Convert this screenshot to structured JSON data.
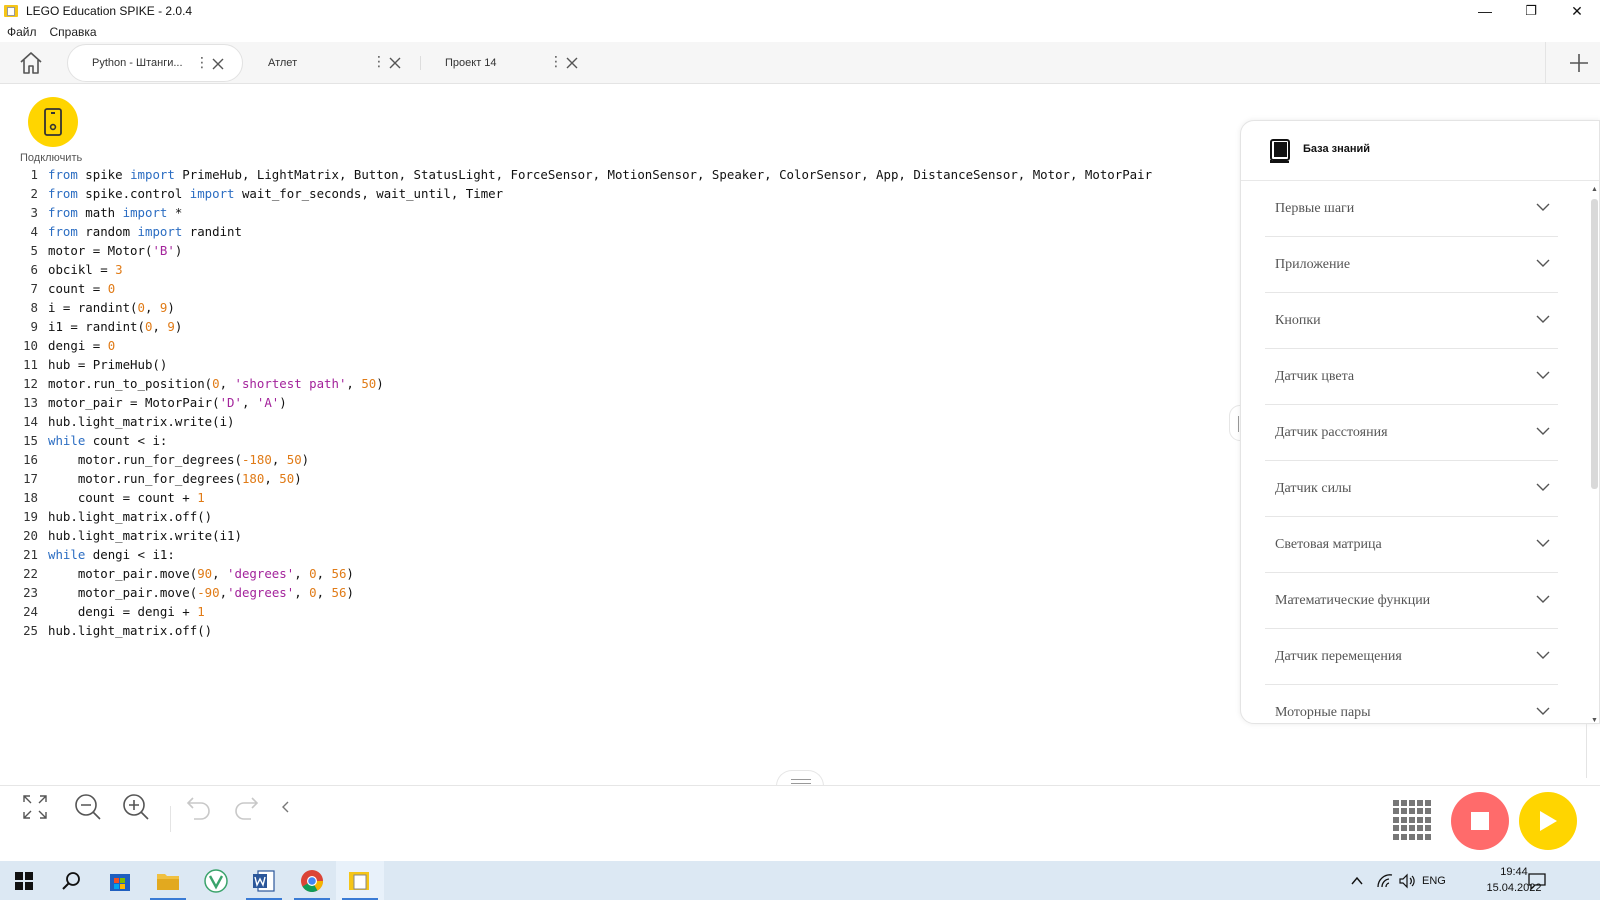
{
  "window": {
    "title": "LEGO Education SPIKE - 2.0.4",
    "controls": {
      "minimize": "—",
      "maximize": "❐",
      "close": "✕"
    }
  },
  "menu": {
    "items": [
      "Файл",
      "Справка"
    ]
  },
  "tabs": [
    {
      "label": "Python - Штанги...",
      "active": true
    },
    {
      "label": "Атлет",
      "active": false
    },
    {
      "label": "Проект 14",
      "active": false
    }
  ],
  "connect": {
    "label": "Подключить"
  },
  "code": {
    "lines": [
      [
        [
          "kw",
          "from"
        ],
        [
          "txt",
          " spike "
        ],
        [
          "kw",
          "import"
        ],
        [
          "txt",
          " PrimeHub, LightMatrix, Button, StatusLight, ForceSensor, MotionSensor, Speaker, ColorSensor, App, DistanceSensor, Motor, MotorPair"
        ]
      ],
      [
        [
          "kw",
          "from"
        ],
        [
          "txt",
          " spike.control "
        ],
        [
          "kw",
          "import"
        ],
        [
          "txt",
          " wait_for_seconds, wait_until, Timer"
        ]
      ],
      [
        [
          "kw",
          "from"
        ],
        [
          "txt",
          " math "
        ],
        [
          "kw",
          "import"
        ],
        [
          "txt",
          " *"
        ]
      ],
      [
        [
          "kw",
          "from"
        ],
        [
          "txt",
          " random "
        ],
        [
          "kw",
          "import"
        ],
        [
          "txt",
          " randint"
        ]
      ],
      [
        [
          "txt",
          "motor = Motor("
        ],
        [
          "str",
          "'B'"
        ],
        [
          "txt",
          ")"
        ]
      ],
      [
        [
          "txt",
          "obcikl = "
        ],
        [
          "num",
          "3"
        ]
      ],
      [
        [
          "txt",
          "count = "
        ],
        [
          "num",
          "0"
        ]
      ],
      [
        [
          "txt",
          "i = randint("
        ],
        [
          "num",
          "0"
        ],
        [
          "txt",
          ", "
        ],
        [
          "num",
          "9"
        ],
        [
          "txt",
          ")"
        ]
      ],
      [
        [
          "txt",
          "i1 = randint("
        ],
        [
          "num",
          "0"
        ],
        [
          "txt",
          ", "
        ],
        [
          "num",
          "9"
        ],
        [
          "txt",
          ")"
        ]
      ],
      [
        [
          "txt",
          "dengi = "
        ],
        [
          "num",
          "0"
        ]
      ],
      [
        [
          "txt",
          "hub = PrimeHub()"
        ]
      ],
      [
        [
          "txt",
          "motor.run_to_position("
        ],
        [
          "num",
          "0"
        ],
        [
          "txt",
          ", "
        ],
        [
          "str",
          "'shortest path'"
        ],
        [
          "txt",
          ", "
        ],
        [
          "num",
          "50"
        ],
        [
          "txt",
          ")"
        ]
      ],
      [
        [
          "txt",
          "motor_pair = MotorPair("
        ],
        [
          "str",
          "'D'"
        ],
        [
          "txt",
          ", "
        ],
        [
          "str",
          "'A'"
        ],
        [
          "txt",
          ")"
        ]
      ],
      [
        [
          "txt",
          "hub.light_matrix.write(i)"
        ]
      ],
      [
        [
          "kw",
          "while"
        ],
        [
          "txt",
          " count < i:"
        ]
      ],
      [
        [
          "txt",
          "    motor.run_for_degrees("
        ],
        [
          "num",
          "-180"
        ],
        [
          "txt",
          ", "
        ],
        [
          "num",
          "50"
        ],
        [
          "txt",
          ")"
        ]
      ],
      [
        [
          "txt",
          "    motor.run_for_degrees("
        ],
        [
          "num",
          "180"
        ],
        [
          "txt",
          ", "
        ],
        [
          "num",
          "50"
        ],
        [
          "txt",
          ")"
        ]
      ],
      [
        [
          "txt",
          "    count = count + "
        ],
        [
          "num",
          "1"
        ]
      ],
      [
        [
          "txt",
          "hub.light_matrix.off()"
        ]
      ],
      [
        [
          "txt",
          "hub.light_matrix.write(i1)"
        ]
      ],
      [
        [
          "kw",
          "while"
        ],
        [
          "txt",
          " dengi < i1:"
        ]
      ],
      [
        [
          "txt",
          "    motor_pair.move("
        ],
        [
          "num",
          "90"
        ],
        [
          "txt",
          ", "
        ],
        [
          "str",
          "'degrees'"
        ],
        [
          "txt",
          ", "
        ],
        [
          "num",
          "0"
        ],
        [
          "txt",
          ", "
        ],
        [
          "num",
          "56"
        ],
        [
          "txt",
          ")"
        ]
      ],
      [
        [
          "txt",
          "    motor_pair.move("
        ],
        [
          "num",
          "-90"
        ],
        [
          "txt",
          ","
        ],
        [
          "str",
          "'degrees'"
        ],
        [
          "txt",
          ", "
        ],
        [
          "num",
          "0"
        ],
        [
          "txt",
          ", "
        ],
        [
          "num",
          "56"
        ],
        [
          "txt",
          ")"
        ]
      ],
      [
        [
          "txt",
          "    dengi = dengi + "
        ],
        [
          "num",
          "1"
        ]
      ],
      [
        [
          "txt",
          "hub.light_matrix.off()"
        ]
      ]
    ]
  },
  "knowledge_base": {
    "title": "База знаний",
    "items": [
      "Первые шаги",
      "Приложение",
      "Кнопки",
      "Датчик цвета",
      "Датчик расстояния",
      "Датчик силы",
      "Световая матрица",
      "Математические функции",
      "Датчик перемещения",
      "Моторные пары"
    ]
  },
  "taskbar": {
    "language": "ENG",
    "time": "19:44",
    "date": "15.04.2022"
  },
  "colors": {
    "accent_yellow": "#ffd500",
    "stop_red": "#ff6b6b",
    "keyword": "#2b6dc2",
    "number": "#e07b17",
    "string": "#a3239b"
  }
}
